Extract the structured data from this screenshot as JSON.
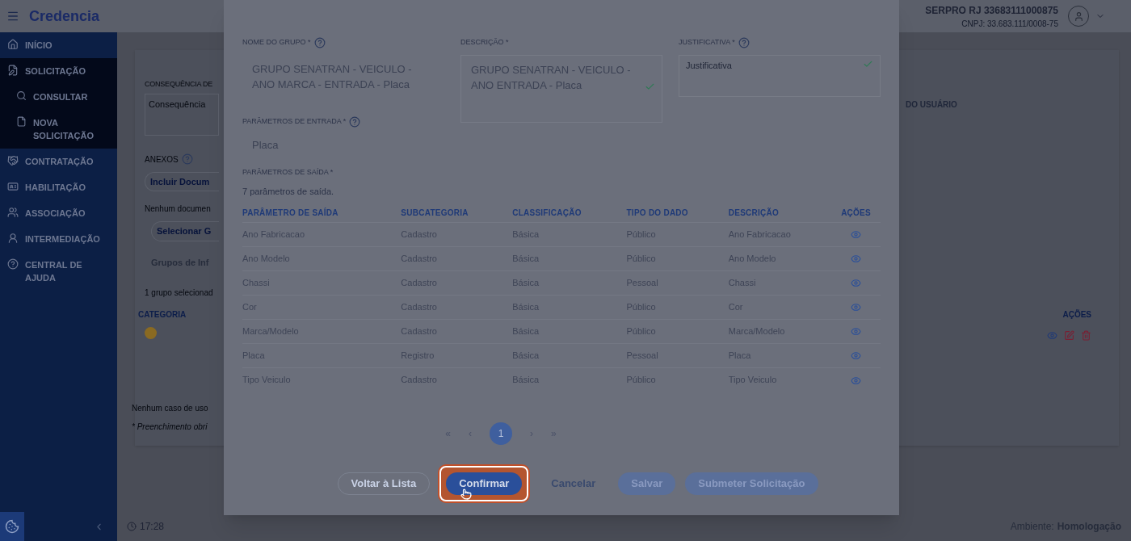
{
  "app": {
    "name": "Credencia"
  },
  "user": {
    "name": "SERPRO RJ 33683111000875",
    "cnpj": "CNPJ: 33.683.111/0008-75"
  },
  "sidebar": {
    "items": [
      {
        "label": "INÍCIO"
      },
      {
        "label": "SOLICITAÇÃO",
        "expanded": true,
        "children": [
          {
            "label": "CONSULTAR"
          },
          {
            "label": "NOVA SOLICITAÇÃO"
          }
        ]
      },
      {
        "label": "CONTRATAÇÃO"
      },
      {
        "label": "HABILITAÇÃO"
      },
      {
        "label": "ASSOCIAÇÃO"
      },
      {
        "label": "INTERMEDIAÇÃO"
      },
      {
        "label": "CENTRAL DE AJUDA"
      }
    ]
  },
  "page": {
    "consequence_label": "CONSEQUÊNCIA DE",
    "consequence_placeholder": "Consequência",
    "attachments_label": "ANEXOS",
    "include_button": "Incluir Docum",
    "no_documents": "Nenhum documen",
    "select_group_button": "Selecionar G",
    "groups_title": "Grupos de Inf",
    "groups_count": "1 grupo selecionad",
    "category_column": "CATEGORIA",
    "no_use_cases": "Nenhum caso de uso",
    "required_note": "* Preenchimento obri",
    "right_fragment": "DO USUÁRIO",
    "actions_column": "AÇÕES"
  },
  "modal": {
    "group_name": {
      "label": "NOME DO GRUPO *",
      "value": "GRUPO SENATRAN - VEICULO - ANO MARCA - ENTRADA - Placa"
    },
    "description": {
      "label": "DESCRIÇÃO *",
      "value": "GRUPO SENATRAN - VEICULO - ANO ENTRADA - Placa",
      "valid": true
    },
    "justification": {
      "label": "JUSTIFICATIVA *",
      "placeholder": "Justificativa",
      "valid": true
    },
    "input_params": {
      "label": "PARÂMETROS DE ENTRADA *",
      "value": "Placa"
    },
    "output_params": {
      "label": "PARÂMETROS DE SAÍDA *",
      "count": "7 parâmetros de saída."
    },
    "table": {
      "columns": [
        "PARÂMETRO DE SAÍDA",
        "SUBCATEGORIA",
        "CLASSIFICAÇÃO",
        "TIPO DO DADO",
        "DESCRIÇÃO",
        "AÇÕES"
      ],
      "rows": [
        [
          "Ano Fabricacao",
          "Cadastro",
          "Básica",
          "Público",
          "Ano Fabricacao"
        ],
        [
          "Ano Modelo",
          "Cadastro",
          "Básica",
          "Público",
          "Ano Modelo"
        ],
        [
          "Chassi",
          "Cadastro",
          "Básica",
          "Pessoal",
          "Chassi"
        ],
        [
          "Cor",
          "Cadastro",
          "Básica",
          "Público",
          "Cor"
        ],
        [
          "Marca/Modelo",
          "Cadastro",
          "Básica",
          "Público",
          "Marca/Modelo"
        ],
        [
          "Placa",
          "Registro",
          "Básica",
          "Pessoal",
          "Placa"
        ],
        [
          "Tipo Veiculo",
          "Cadastro",
          "Básica",
          "Público",
          "Tipo Veiculo"
        ]
      ]
    },
    "pagination": {
      "first": "«",
      "prev": "‹",
      "pages": [
        {
          "label": "1",
          "selected": true
        }
      ],
      "next": "›",
      "last": "»"
    },
    "buttons": [
      {
        "label": "Voltar à Lista",
        "kind": "outline",
        "highlighted": false
      },
      {
        "label": "Confirmar",
        "kind": "primary",
        "highlighted": true
      },
      {
        "label": "Cancelar",
        "kind": "link",
        "highlighted": false
      },
      {
        "label": "Salvar",
        "kind": "faded",
        "highlighted": false
      },
      {
        "label": "Submeter Solicitação",
        "kind": "faded",
        "highlighted": false
      }
    ]
  },
  "status_bar": {
    "time": "17:28",
    "environment_label": "Ambiente:",
    "environment": "Homologação"
  }
}
